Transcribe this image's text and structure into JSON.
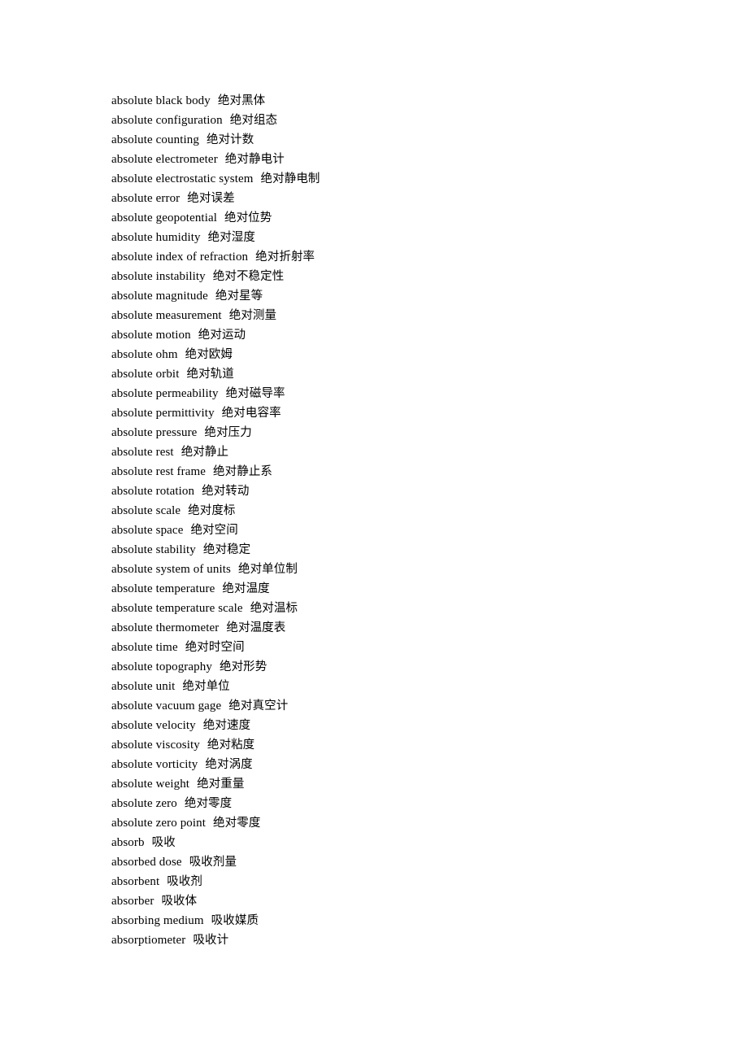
{
  "document": {
    "type": "bilingual-glossary",
    "page_background": "#ffffff",
    "text_color": "#000000",
    "entries": [
      {
        "en": "absolute black body",
        "zh": "绝对黑体"
      },
      {
        "en": "absolute configuration",
        "zh": "绝对组态"
      },
      {
        "en": "absolute counting",
        "zh": "绝对计数"
      },
      {
        "en": "absolute electrometer",
        "zh": "绝对静电计"
      },
      {
        "en": "absolute electrostatic system",
        "zh": "绝对静电制"
      },
      {
        "en": "absolute error",
        "zh": "绝对误差"
      },
      {
        "en": "absolute geopotential",
        "zh": "绝对位势"
      },
      {
        "en": "absolute humidity",
        "zh": "绝对湿度"
      },
      {
        "en": "absolute index of refraction",
        "zh": "绝对折射率"
      },
      {
        "en": "absolute instability",
        "zh": "绝对不稳定性"
      },
      {
        "en": "absolute magnitude",
        "zh": "绝对星等"
      },
      {
        "en": "absolute measurement",
        "zh": "绝对测量"
      },
      {
        "en": "absolute motion",
        "zh": "绝对运动"
      },
      {
        "en": "absolute ohm",
        "zh": "绝对欧姆"
      },
      {
        "en": "absolute orbit",
        "zh": "绝对轨道"
      },
      {
        "en": "absolute permeability",
        "zh": "绝对磁导率"
      },
      {
        "en": "absolute permittivity",
        "zh": "绝对电容率"
      },
      {
        "en": "absolute pressure",
        "zh": "绝对压力"
      },
      {
        "en": "absolute rest",
        "zh": "绝对静止"
      },
      {
        "en": "absolute rest frame",
        "zh": "绝对静止系"
      },
      {
        "en": "absolute rotation",
        "zh": "绝对转动"
      },
      {
        "en": "absolute scale",
        "zh": "绝对度标"
      },
      {
        "en": "absolute space",
        "zh": "绝对空间"
      },
      {
        "en": "absolute stability",
        "zh": "绝对稳定"
      },
      {
        "en": "absolute system of units",
        "zh": "绝对单位制"
      },
      {
        "en": "absolute temperature",
        "zh": "绝对温度"
      },
      {
        "en": "absolute temperature scale",
        "zh": "绝对温标"
      },
      {
        "en": "absolute thermometer",
        "zh": "绝对温度表"
      },
      {
        "en": "absolute time",
        "zh": "绝对时空间"
      },
      {
        "en": "absolute topography",
        "zh": "绝对形势"
      },
      {
        "en": "absolute unit",
        "zh": "绝对单位"
      },
      {
        "en": "absolute vacuum gage",
        "zh": "绝对真空计"
      },
      {
        "en": "absolute velocity",
        "zh": "绝对速度"
      },
      {
        "en": "absolute viscosity",
        "zh": "绝对粘度"
      },
      {
        "en": "absolute vorticity",
        "zh": "绝对涡度"
      },
      {
        "en": "absolute weight",
        "zh": "绝对重量"
      },
      {
        "en": "absolute zero",
        "zh": "绝对零度"
      },
      {
        "en": "absolute zero point",
        "zh": "绝对零度"
      },
      {
        "en": "absorb",
        "zh": "吸收"
      },
      {
        "en": "absorbed dose",
        "zh": "吸收剂量"
      },
      {
        "en": "absorbent",
        "zh": "吸收剂"
      },
      {
        "en": "absorber",
        "zh": "吸收体"
      },
      {
        "en": "absorbing medium",
        "zh": "吸收媒质"
      },
      {
        "en": "absorptiometer",
        "zh": "吸收计"
      }
    ]
  }
}
